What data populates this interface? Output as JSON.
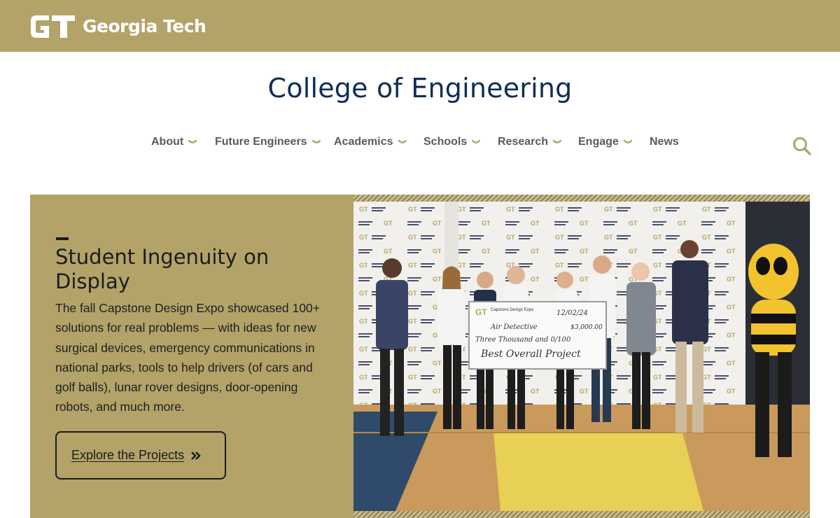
{
  "header": {
    "brand": "Georgia Tech",
    "logo_monogram": "GT",
    "college_title": "College of Engineering"
  },
  "nav": {
    "items": [
      {
        "label": "About",
        "has_dropdown": true
      },
      {
        "label": "Future Engineers",
        "has_dropdown": true
      },
      {
        "label": "Academics",
        "has_dropdown": true
      },
      {
        "label": "Schools",
        "has_dropdown": true
      },
      {
        "label": "Research",
        "has_dropdown": true
      },
      {
        "label": "Engage",
        "has_dropdown": true
      },
      {
        "label": "News",
        "has_dropdown": false
      }
    ],
    "search_icon": "search-icon"
  },
  "hero": {
    "title": "Student Ingenuity on Display",
    "body": "The fall Capstone Design Expo showcased 100+ solutions for real problems — with ideas for new surgical devices, emergency communications in national parks, tools to help drivers (of cars and golf balls), lunar rover designs, door-opening robots, and much more.",
    "cta_label": "Explore the Projects",
    "cta_icon": "double-chevron-right-icon",
    "photo": {
      "backdrop_brand": "Capstone Design Expo",
      "check": {
        "header": "Capstone Design Expo",
        "date": "12/02/24",
        "payee": "Air Detective",
        "amount": "$3,000.00",
        "amount_words": "Three Thousand and 0/100",
        "memo": "Best Overall Project"
      }
    }
  },
  "colors": {
    "gold": "#b3a369",
    "navy": "#0f2e55",
    "nav_text": "#5b5b5b"
  }
}
